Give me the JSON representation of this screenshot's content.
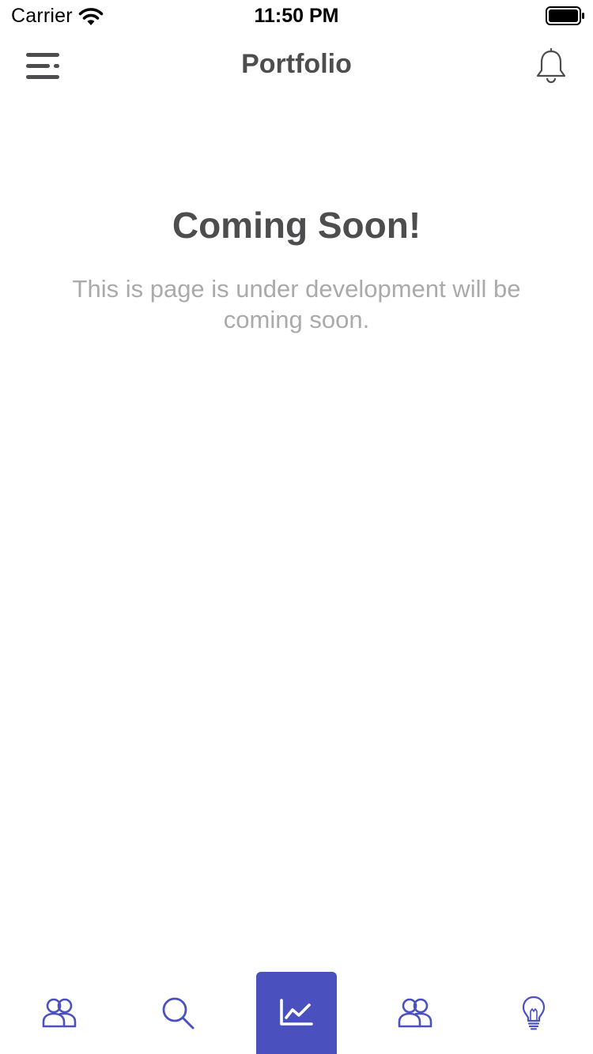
{
  "status_bar": {
    "carrier": "Carrier",
    "time": "11:50 PM",
    "icons": [
      "wifi-icon",
      "battery-icon"
    ]
  },
  "header": {
    "title": "Portfolio",
    "left_icon": "menu-icon",
    "right_icon": "bell-icon"
  },
  "main": {
    "heading": "Coming Soon!",
    "message": "This is page is under development will be coming soon."
  },
  "tabbar": {
    "tabs": [
      {
        "icon": "users-icon",
        "active": false
      },
      {
        "icon": "search-icon",
        "active": false
      },
      {
        "icon": "chart-line-icon",
        "active": true
      },
      {
        "icon": "users-icon",
        "active": false
      },
      {
        "icon": "lightbulb-icon",
        "active": false
      }
    ]
  },
  "colors": {
    "accent": "#4a51be",
    "title_text": "#4d4d4f",
    "muted_text": "#aaaaaa",
    "background": "#ffffff"
  }
}
